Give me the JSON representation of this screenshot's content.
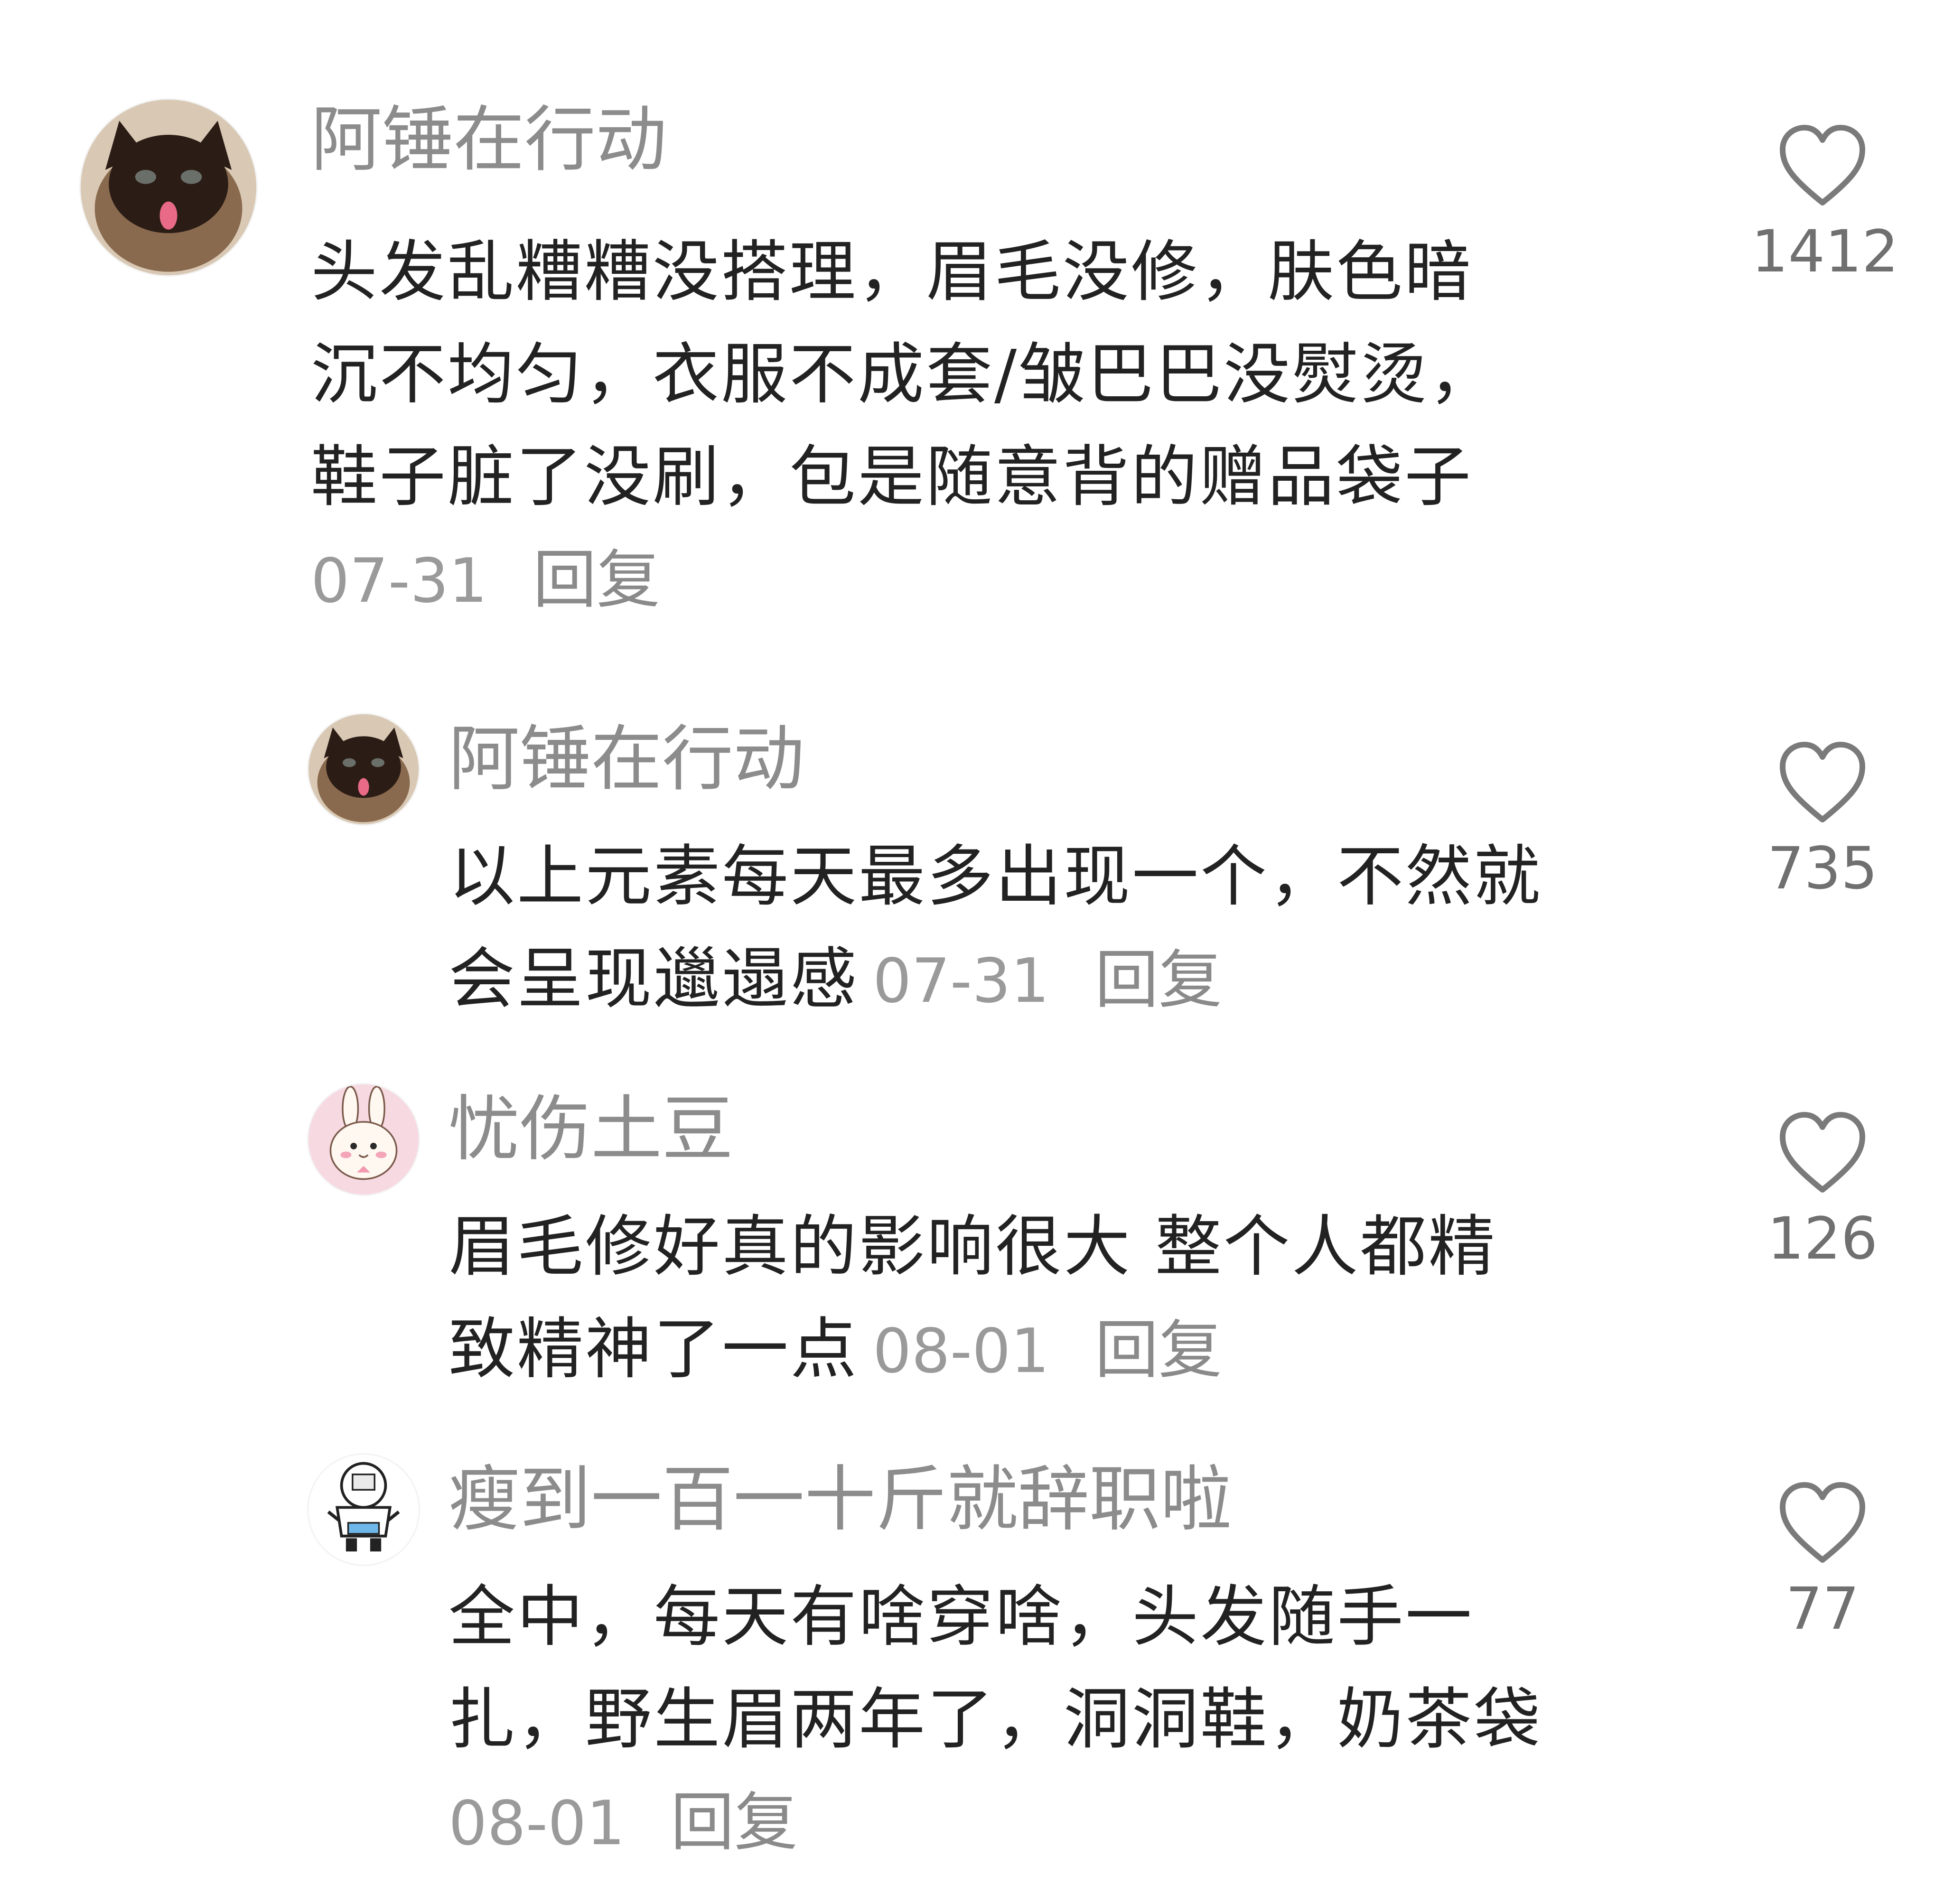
{
  "comments": [
    {
      "username": "阿锤在行动",
      "lines": [
        "头发乱糟糟没搭理，眉毛没修，肤色暗",
        "沉不均匀，衣服不成套/皱巴巴没熨烫，",
        "鞋子脏了没刷，包是随意背的赠品袋子"
      ],
      "date": "07-31",
      "reply_label": "回复",
      "likes": "1412",
      "avatar_icon": "cat-avatar-icon"
    },
    {
      "username": "阿锤在行动",
      "lines": [
        "以上元素每天最多出现一个，不然就",
        "会呈现邋遢感"
      ],
      "date": "07-31",
      "reply_label": "回复",
      "likes": "735",
      "avatar_icon": "cat-avatar-icon"
    },
    {
      "username": "忧伤土豆",
      "lines": [
        "眉毛修好真的影响很大 整个人都精",
        "致精神了一点"
      ],
      "date": "08-01",
      "reply_label": "回复",
      "likes": "126",
      "avatar_icon": "bunny-avatar-icon"
    },
    {
      "username": "瘦到一百一十斤就辞职啦",
      "lines": [
        "全中，每天有啥穿啥，头发随手一",
        "扎，野生眉两年了，洞洞鞋，奶茶袋"
      ],
      "date": "08-01",
      "reply_label": "回复",
      "likes": "77",
      "avatar_icon": "cartoon-avatar-icon"
    }
  ],
  "colors": {
    "username": "#8c8c8c",
    "text": "#222222",
    "meta": "#9a9a9a",
    "heart_outline": "#7a7a7a"
  }
}
